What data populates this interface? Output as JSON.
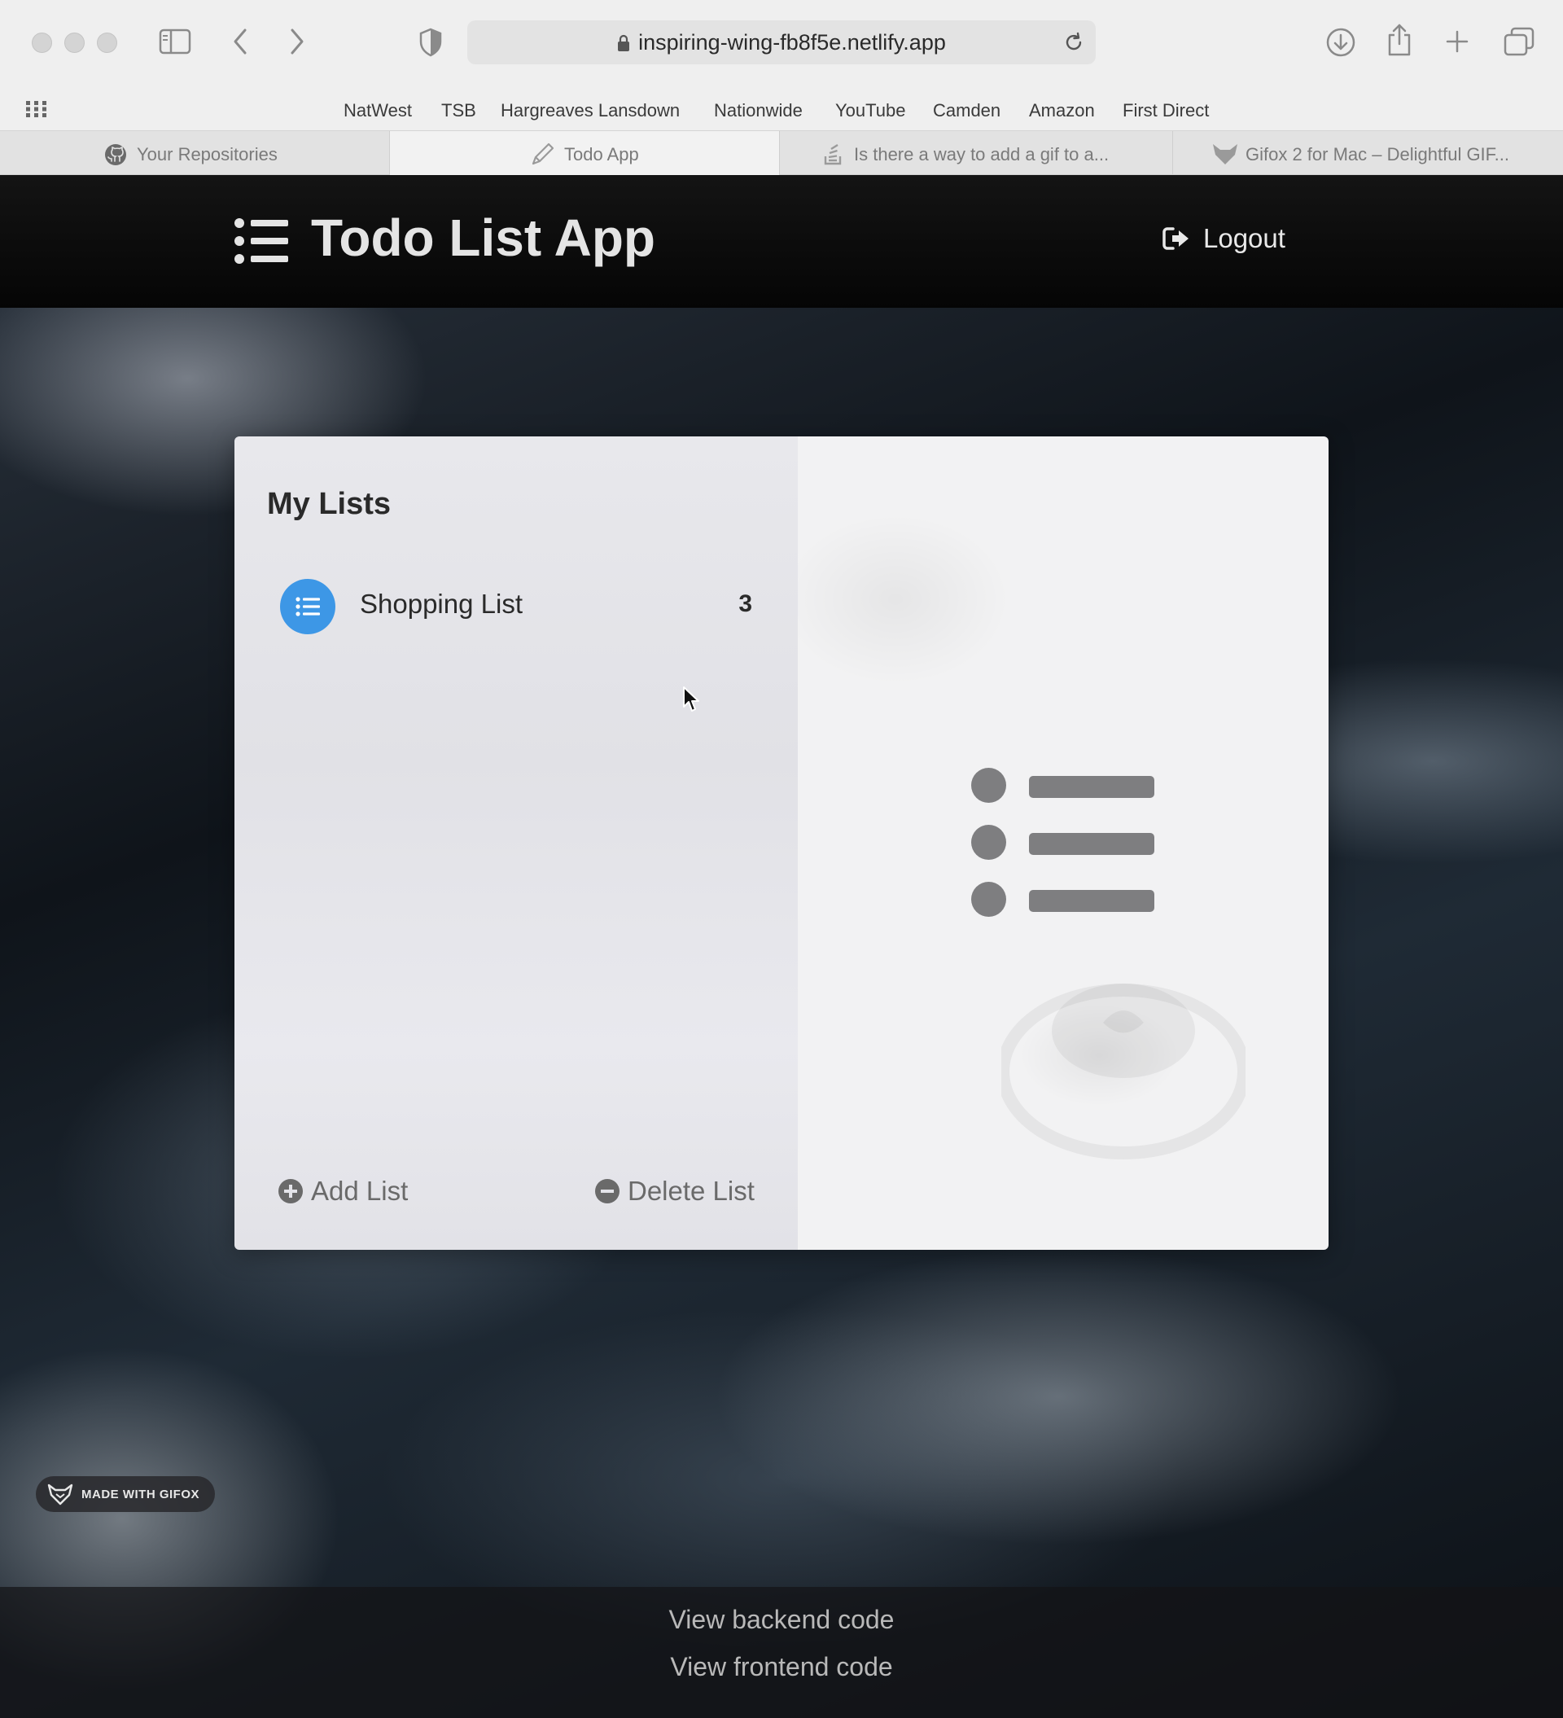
{
  "browser": {
    "url": "inspiring-wing-fb8f5e.netlify.app",
    "bookmarks": [
      "NatWest",
      "TSB",
      "Hargreaves Lansdown",
      "Nationwide",
      "YouTube",
      "Camden",
      "Amazon",
      "First Direct"
    ],
    "tabs": [
      {
        "label": "Your Repositories",
        "icon": "github-icon",
        "active": false
      },
      {
        "label": "Todo App",
        "icon": "pencil-icon",
        "active": true
      },
      {
        "label": "Is there a way to add a gif to a...",
        "icon": "stackoverflow-icon",
        "active": false
      },
      {
        "label": "Gifox 2 for Mac – Delightful GIF...",
        "icon": "gifox-icon",
        "active": false
      }
    ]
  },
  "app": {
    "title": "Todo List App",
    "logout_label": "Logout"
  },
  "lists_panel": {
    "title": "My Lists",
    "lists": [
      {
        "name": "Shopping List",
        "count": "3"
      }
    ],
    "add_label": "Add List",
    "delete_label": "Delete List"
  },
  "footer": {
    "backend_link": "View backend code",
    "frontend_link": "View frontend code"
  },
  "watermark": {
    "label": "MADE WITH GIFOX"
  },
  "colors": {
    "accent": "#3d97e6",
    "navbar": "#0a0a0a",
    "panel": "#e4e4e9"
  }
}
